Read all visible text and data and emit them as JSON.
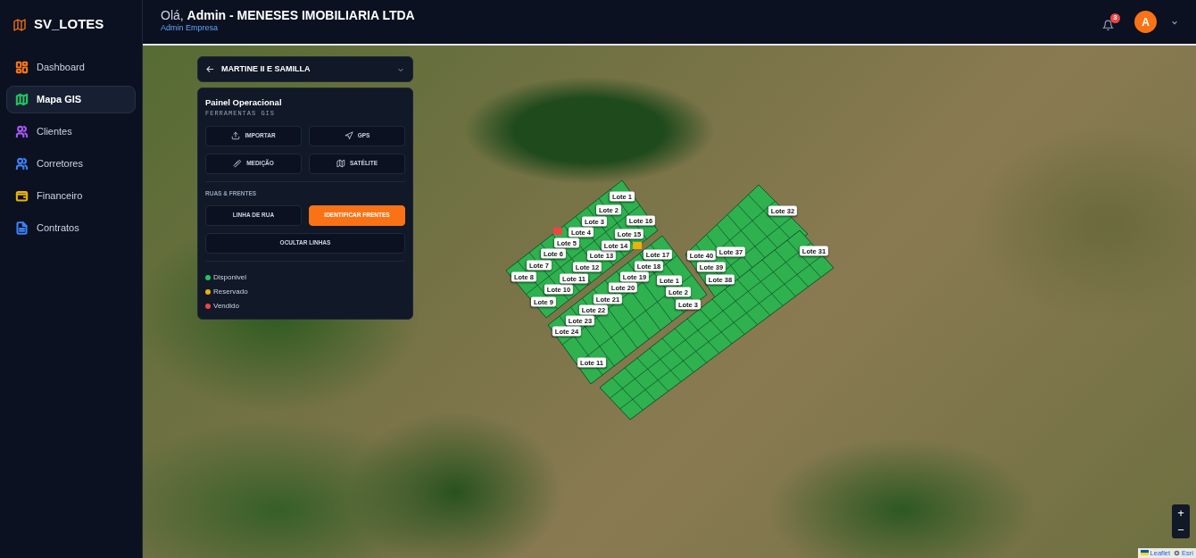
{
  "brand": {
    "name": "SV_LOTES"
  },
  "sidebar": {
    "items": [
      {
        "label": "Dashboard",
        "selected": false,
        "color": "#f97316"
      },
      {
        "label": "Mapa GIS",
        "selected": true,
        "color": "#22c55e"
      },
      {
        "label": "Clientes",
        "selected": false,
        "color": "#a855f7"
      },
      {
        "label": "Corretores",
        "selected": false,
        "color": "#3b82f6"
      },
      {
        "label": "Financeiro",
        "selected": false,
        "color": "#eab308"
      },
      {
        "label": "Contratos",
        "selected": false,
        "color": "#3b82f6"
      }
    ]
  },
  "header": {
    "greeting": "Olá, **Admin - MENESES IMOBILIARIA LTDA**",
    "subtitle": "Admin Empresa",
    "notifications": "3",
    "avatar": "A"
  },
  "project": {
    "title": "MARTINE II E SAMILLA"
  },
  "panel": {
    "title": "Painel Operacional",
    "subtitle": "FERRAMENTAS GIS",
    "tools": [
      {
        "label": "IMPORTAR"
      },
      {
        "label": "GPS"
      },
      {
        "label": "MEDIÇÃO"
      },
      {
        "label": "SATÉLITE"
      }
    ],
    "section": "RUAS & FRENTES",
    "street_buttons": [
      {
        "label": "LINHA DE RUA",
        "selected": false
      },
      {
        "label": "IDENTIFICAR FRENTES",
        "selected": true
      },
      {
        "label": "OCULTAR LINHAS",
        "selected": false
      }
    ],
    "legend": [
      {
        "label": "Disponivel",
        "color": "#22c55e"
      },
      {
        "label": "Reservado",
        "color": "#eab308"
      },
      {
        "label": "Vendido",
        "color": "#ef4444"
      }
    ]
  },
  "map": {
    "lots": [
      {
        "label": "Lote 1"
      },
      {
        "label": "Lote 2"
      },
      {
        "label": "Lote 3"
      },
      {
        "label": "Lote 4"
      },
      {
        "label": "Lote 5"
      },
      {
        "label": "Lote 6"
      },
      {
        "label": "Lote 7"
      },
      {
        "label": "Lote 8"
      },
      {
        "label": "Lote 9"
      },
      {
        "label": "Lote 10"
      },
      {
        "label": "Lote 11"
      },
      {
        "label": "Lote 12"
      },
      {
        "label": "Lote 13"
      },
      {
        "label": "Lote 14"
      },
      {
        "label": "Lote 15"
      },
      {
        "label": "Lote 16"
      },
      {
        "label": "Lote 17"
      },
      {
        "label": "Lote 18"
      },
      {
        "label": "Lote 19"
      },
      {
        "label": "Lote 20"
      },
      {
        "label": "Lote 21"
      },
      {
        "label": "Lote 22"
      },
      {
        "label": "Lote 23"
      },
      {
        "label": "Lote 24"
      },
      {
        "label": "Lote 11"
      },
      {
        "label": "Lote 1"
      },
      {
        "label": "Lote 2"
      },
      {
        "label": "Lote 3"
      },
      {
        "label": "Lote 32"
      },
      {
        "label": "Lote 31"
      },
      {
        "label": "Lote 40"
      },
      {
        "label": "Lote 37"
      },
      {
        "label": "Lote 39"
      },
      {
        "label": "Lote 38"
      }
    ],
    "parcels": [
      {
        "color": "#ef4444"
      },
      {
        "color": "#eab308"
      }
    ],
    "zoom_in": "+",
    "zoom_out": "−",
    "attribution": [
      {
        "label": "Leaflet"
      },
      {
        "label": "Esri"
      }
    ]
  }
}
